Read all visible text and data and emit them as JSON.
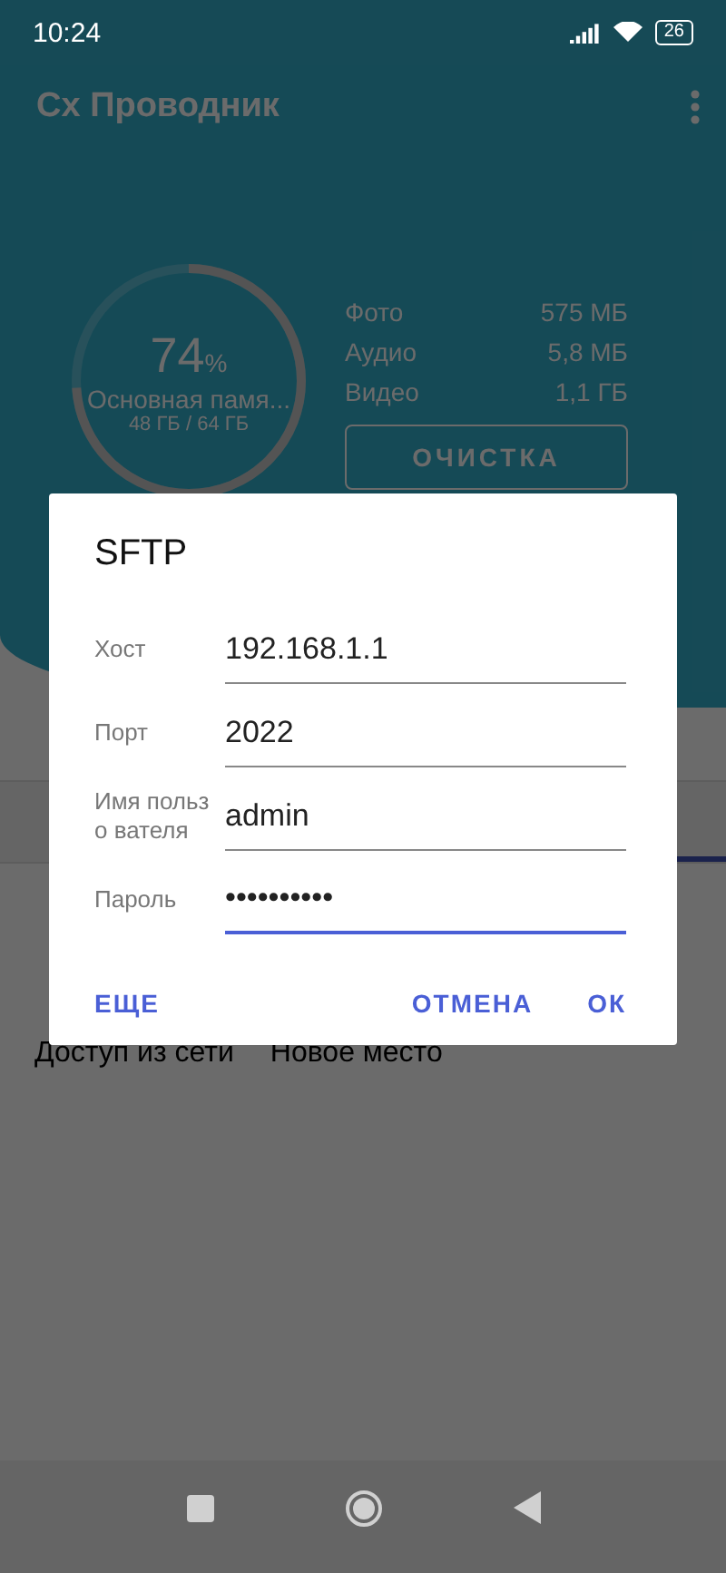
{
  "status_bar": {
    "time": "10:24",
    "battery": "26"
  },
  "toolbar": {
    "title": "Cx Проводник"
  },
  "storage": {
    "percent": "74",
    "percent_sign": "%",
    "name": "Основная памя...",
    "usage": "48 ГБ / 64 ГБ",
    "level": 0.74,
    "stats": [
      {
        "label": "Фото",
        "value": "575 МБ"
      },
      {
        "label": "Аудио",
        "value": "5,8 МБ"
      },
      {
        "label": "Видео",
        "value": "1,1 ГБ"
      }
    ],
    "clean_button": "ОЧИСТКА"
  },
  "links": [
    "Доступ из сети",
    "Новое место"
  ],
  "dialog": {
    "title": "SFTP",
    "fields": [
      {
        "label": "Хост",
        "value": "192.168.1.1",
        "focused": false
      },
      {
        "label": "Порт",
        "value": "2022",
        "focused": false
      },
      {
        "label": "Имя пользо вателя",
        "value": "admin",
        "focused": false
      },
      {
        "label": "Пароль",
        "value": "••••••••••",
        "focused": true
      }
    ],
    "buttons": {
      "more": "ЕЩЕ",
      "cancel": "ОТМЕНА",
      "ok": "ОК"
    }
  }
}
